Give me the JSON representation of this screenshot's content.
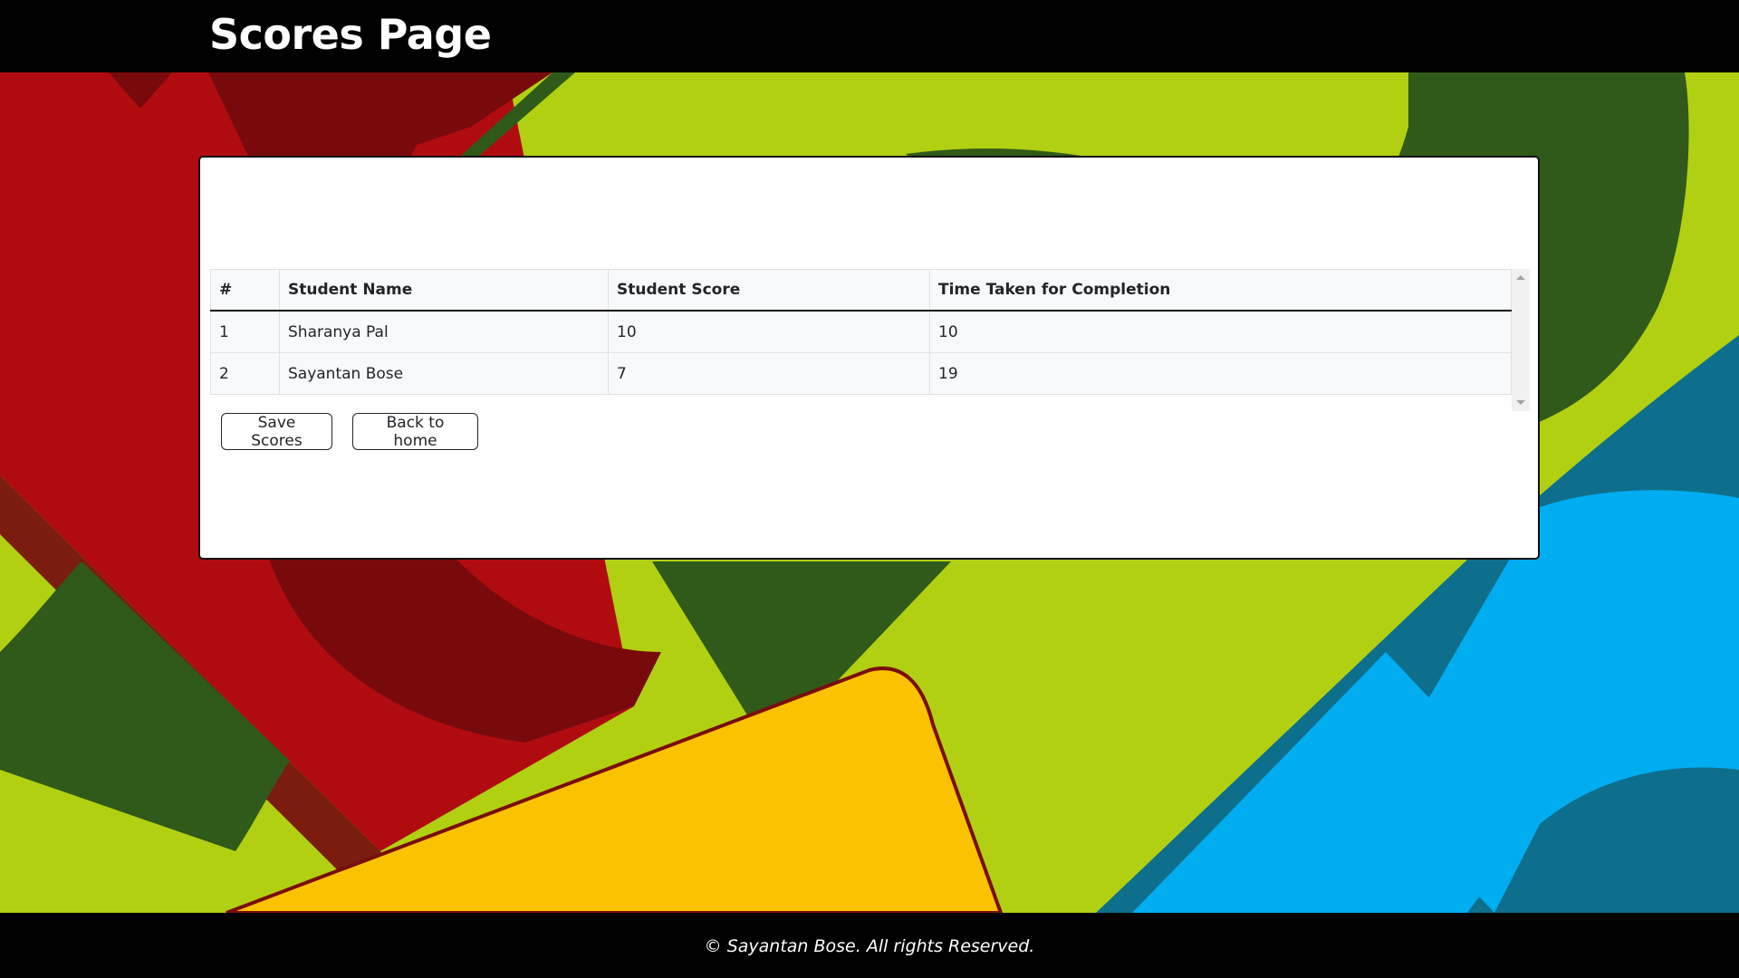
{
  "header": {
    "title": "Scores Page"
  },
  "table": {
    "columns": [
      "#",
      "Student Name",
      "Student Score",
      "Time Taken for Completion"
    ],
    "rows": [
      [
        "1",
        "Sharanya Pal",
        "10",
        "10"
      ],
      [
        "2",
        "Sayantan Bose",
        "7",
        "19"
      ]
    ]
  },
  "buttons": {
    "save_label": "Save Scores",
    "home_label": "Back to home"
  },
  "footer": {
    "copyright": "© Sayantan Bose. All rights Reserved."
  },
  "colors": {
    "lime": "#b1d011",
    "red": "#b00c10",
    "dark_red": "#790a0c",
    "dark_green": "#2f5a19",
    "yellow": "#fbc200",
    "sky_blue": "#01adf1",
    "teal_blue": "#0e6f8c"
  }
}
